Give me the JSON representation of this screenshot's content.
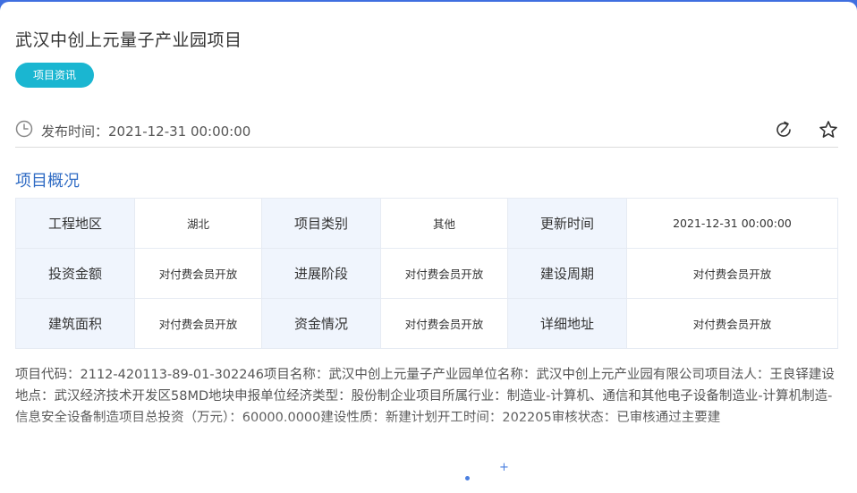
{
  "project": {
    "title": "武汉中创上元量子产业园项目",
    "tag": "项目资讯",
    "publish_label": "发布时间：",
    "publish_time": "2021-12-31 00:00:00"
  },
  "icons": {
    "clock": "clock-icon",
    "share": "share-icon",
    "favorite": "star-icon"
  },
  "overview": {
    "title": "项目概况",
    "rows": [
      [
        {
          "key": "工程地区",
          "value": "湖北"
        },
        {
          "key": "项目类别",
          "value": "其他"
        },
        {
          "key": "更新时间",
          "value": "2021-12-31 00:00:00"
        }
      ],
      [
        {
          "key": "投资金额",
          "value": "对付费会员开放"
        },
        {
          "key": "进展阶段",
          "value": "对付费会员开放"
        },
        {
          "key": "建设周期",
          "value": "对付费会员开放"
        }
      ],
      [
        {
          "key": "建筑面积",
          "value": "对付费会员开放"
        },
        {
          "key": "资金情况",
          "value": "对付费会员开放"
        },
        {
          "key": "详细地址",
          "value": "对付费会员开放"
        }
      ]
    ]
  },
  "description": "项目代码：2112-420113-89-01-302246项目名称：武汉中创上元量子产业园单位名称：武汉中创上元产业园有限公司项目法人：王良铎建设地点：武汉经济技术开发区58MD地块申报单位经济类型：股份制企业项目所属行业：制造业-计算机、通信和其他电子设备制造业-计算机制造-信息安全设备制造项目总投资（万元）：60000.0000建设性质：新建计划开工时间：202205审核状态：已审核通过主要建",
  "colors": {
    "accent": "#1ab6d1",
    "section_title": "#2f6bc4",
    "key_cell_bg": "#f0f5fd",
    "top_bar": "#3f6fe0"
  }
}
